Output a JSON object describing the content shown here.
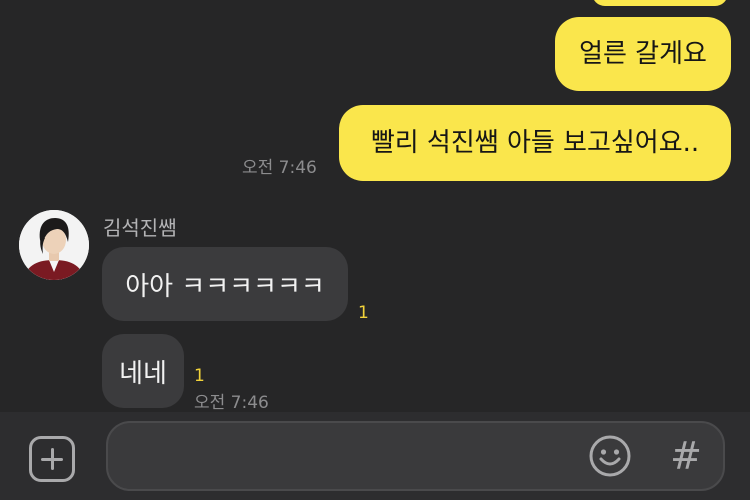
{
  "messages_sent": [
    {
      "text": ""
    },
    {
      "text": "얼른 갈게요"
    },
    {
      "text": "빨리 석진쌤 아들 보고싶어요.."
    }
  ],
  "sent_time": "오전 7:46",
  "incoming": {
    "sender_name": "김석진쌤",
    "messages": [
      {
        "text": "아아 ㅋㅋㅋㅋㅋㅋ",
        "unread": "1"
      },
      {
        "text": "네네",
        "unread": "1"
      }
    ],
    "time": "오전 7:46"
  },
  "input_bar": {
    "placeholder": "",
    "plus_icon": "plus-square-icon",
    "emoji_icon": "smiley-icon",
    "hash_label": "#"
  },
  "colors": {
    "background": "#262627",
    "my_bubble": "#fae64c",
    "other_bubble": "#3b3b3d",
    "unread": "#f2d33a"
  }
}
